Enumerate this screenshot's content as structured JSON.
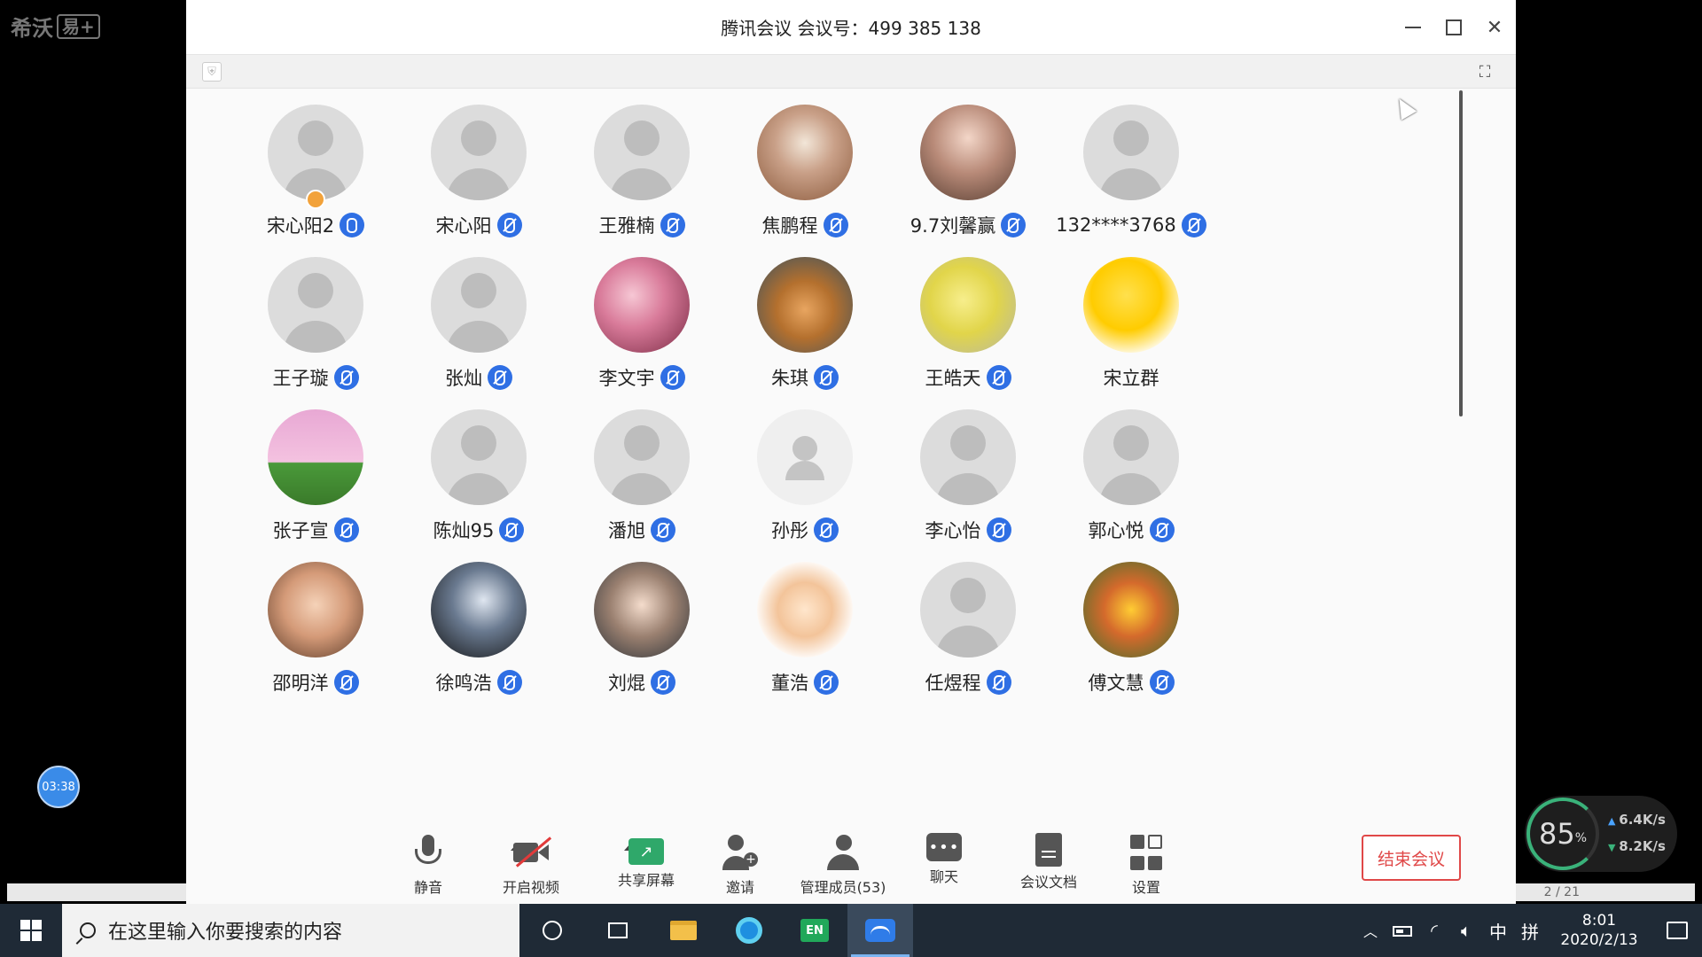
{
  "watermark": {
    "text": "希沃",
    "box": "易+"
  },
  "floating_timer": "03:38",
  "speed_widget": {
    "percent": "85",
    "percent_sign": "%",
    "up": "6.4K/s",
    "down": "8.2K/s"
  },
  "background_page": "2 / 21",
  "window": {
    "title": "腾讯会议 会议号：499 385 138"
  },
  "participants": [
    {
      "name": "宋心阳2",
      "mic": "on",
      "avatar": "default",
      "host": true
    },
    {
      "name": "宋心阳",
      "mic": "muted",
      "avatar": "default"
    },
    {
      "name": "王雅楠",
      "mic": "muted",
      "avatar": "default"
    },
    {
      "name": "焦鹏程",
      "mic": "muted",
      "avatar": "photo1"
    },
    {
      "name": "9.7刘馨赢",
      "mic": "muted",
      "avatar": "photo2"
    },
    {
      "name": "132****3768",
      "mic": "muted",
      "avatar": "default"
    },
    {
      "name": "王子璇",
      "mic": "muted",
      "avatar": "default"
    },
    {
      "name": "张灿",
      "mic": "muted",
      "avatar": "default"
    },
    {
      "name": "李文宇",
      "mic": "muted",
      "avatar": "photo3"
    },
    {
      "name": "朱琪",
      "mic": "muted",
      "avatar": "photo4"
    },
    {
      "name": "王皓天",
      "mic": "muted",
      "avatar": "photo5"
    },
    {
      "name": "宋立群",
      "mic": "none",
      "avatar": "photo6"
    },
    {
      "name": "张子宣",
      "mic": "muted",
      "avatar": "photo7"
    },
    {
      "name": "陈灿95",
      "mic": "muted",
      "avatar": "default"
    },
    {
      "name": "潘旭",
      "mic": "muted",
      "avatar": "default"
    },
    {
      "name": "孙彤",
      "mic": "muted",
      "avatar": "default-light"
    },
    {
      "name": "李心怡",
      "mic": "muted",
      "avatar": "default"
    },
    {
      "name": "郭心悦",
      "mic": "muted",
      "avatar": "default"
    },
    {
      "name": "邵明洋",
      "mic": "muted",
      "avatar": "photo8"
    },
    {
      "name": "徐鸣浩",
      "mic": "muted",
      "avatar": "photo9"
    },
    {
      "name": "刘焜",
      "mic": "muted",
      "avatar": "photo10"
    },
    {
      "name": "董浩",
      "mic": "muted",
      "avatar": "photo11"
    },
    {
      "name": "任煜程",
      "mic": "muted",
      "avatar": "default"
    },
    {
      "name": "傅文慧",
      "mic": "muted",
      "avatar": "photo12"
    }
  ],
  "toolbar": {
    "mute": "静音",
    "video": "开启视频",
    "share": "共享屏幕",
    "invite": "邀请",
    "members": "管理成员(53)",
    "chat": "聊天",
    "docs": "会议文档",
    "settings": "设置",
    "end": "结束会议"
  },
  "taskbar": {
    "search_placeholder": "在这里输入你要搜索的内容",
    "en_label": "EN",
    "tray_ime": "中",
    "tray_ime2": "拼",
    "time": "8:01",
    "date": "2020/2/13"
  },
  "colors": {
    "accent": "#2f6fe4",
    "end_button": "#e04848",
    "share": "#2fa86a"
  }
}
